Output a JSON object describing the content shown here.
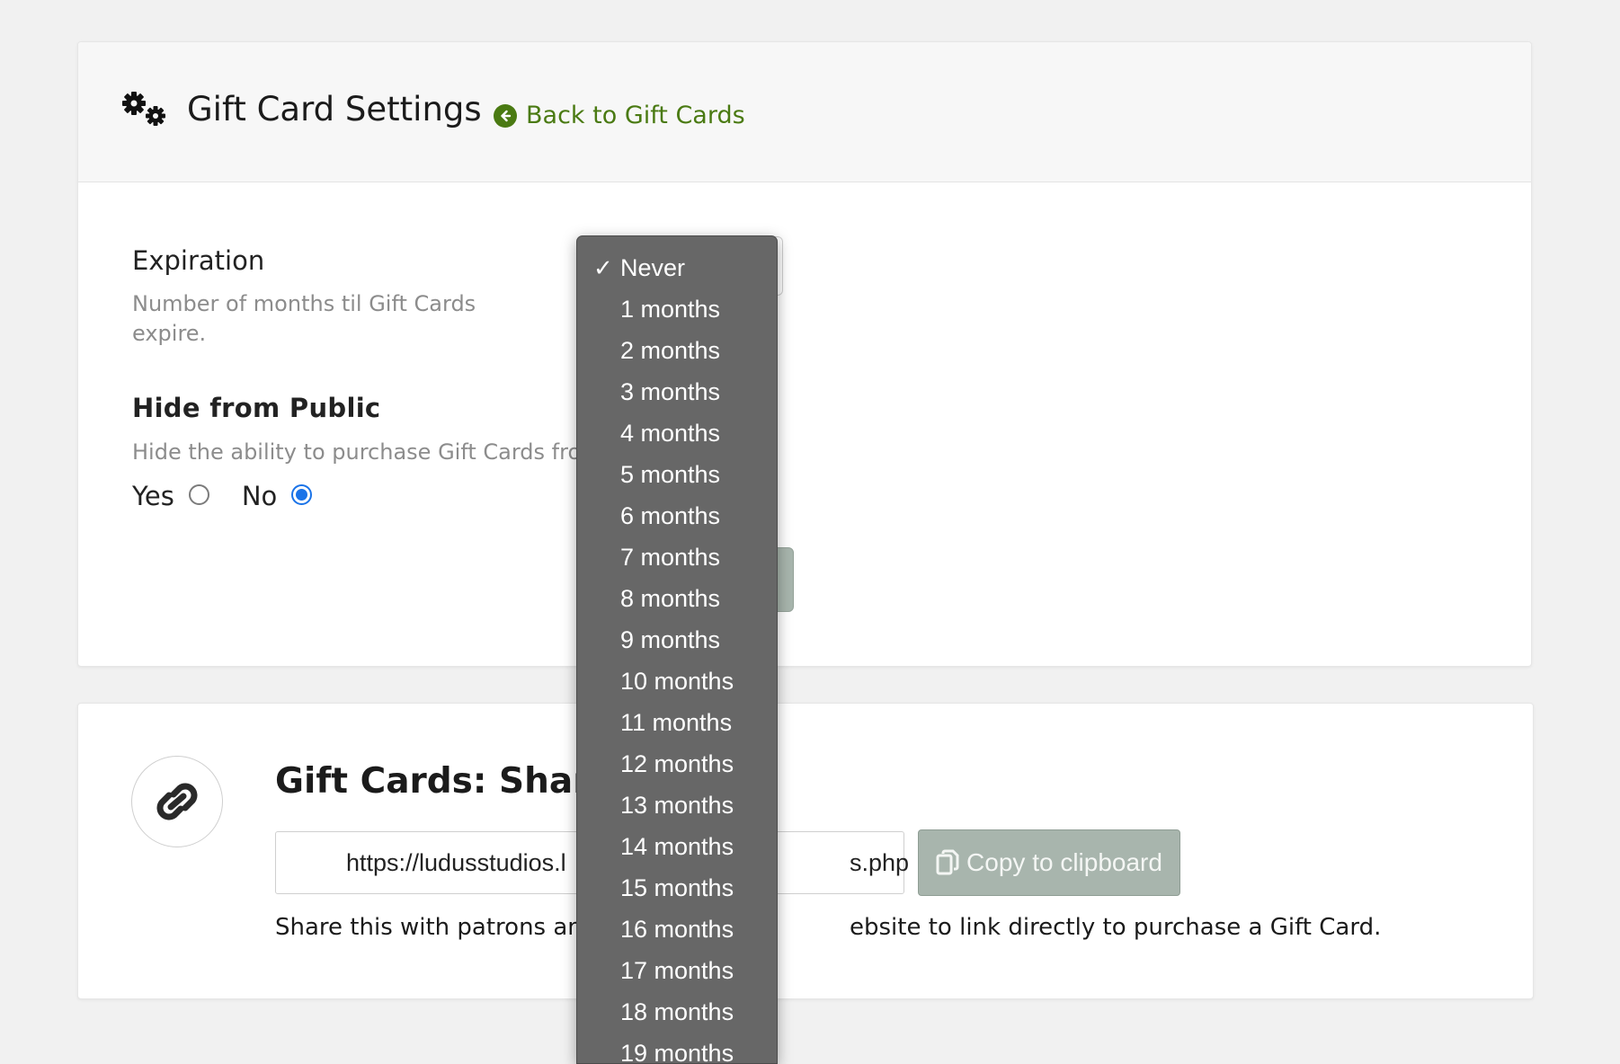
{
  "header": {
    "title": "Gift Card Settings",
    "back_link": "Back to Gift Cards",
    "gears_icon": "gears-icon",
    "back_icon": "arrow-left-circle-icon",
    "accent_color": "#4a7a12"
  },
  "expiration": {
    "label": "Expiration",
    "help": "Number of months til Gift Cards expire.",
    "selected": "Never",
    "options": [
      "Never",
      "1 months",
      "2 months",
      "3 months",
      "4 months",
      "5 months",
      "6 months",
      "7 months",
      "8 months",
      "9 months",
      "10 months",
      "11 months",
      "12 months",
      "13 months",
      "14 months",
      "15 months",
      "16 months",
      "17 months",
      "18 months",
      "19 months"
    ]
  },
  "hide_from_public": {
    "label": "Hide from Public",
    "help": "Hide the ability to purchase Gift Cards fron",
    "yes_label": "Yes",
    "no_label": "No",
    "selected": "No"
  },
  "share": {
    "title": "Gift Cards: Share L",
    "url_visible_start": "https://ludusstudios.l",
    "url_visible_end": "s.php",
    "copy_button": "Copy to clipboard",
    "description_start": "Share this with patrons and",
    "description_end": "ebsite to link directly to purchase a Gift Card.",
    "link_icon": "link-icon",
    "copy_icon": "copy-icon"
  },
  "colors": {
    "radio_selected": "#1a73e8",
    "dropdown_bg": "#676767",
    "button_muted": "#a8b5ad"
  }
}
